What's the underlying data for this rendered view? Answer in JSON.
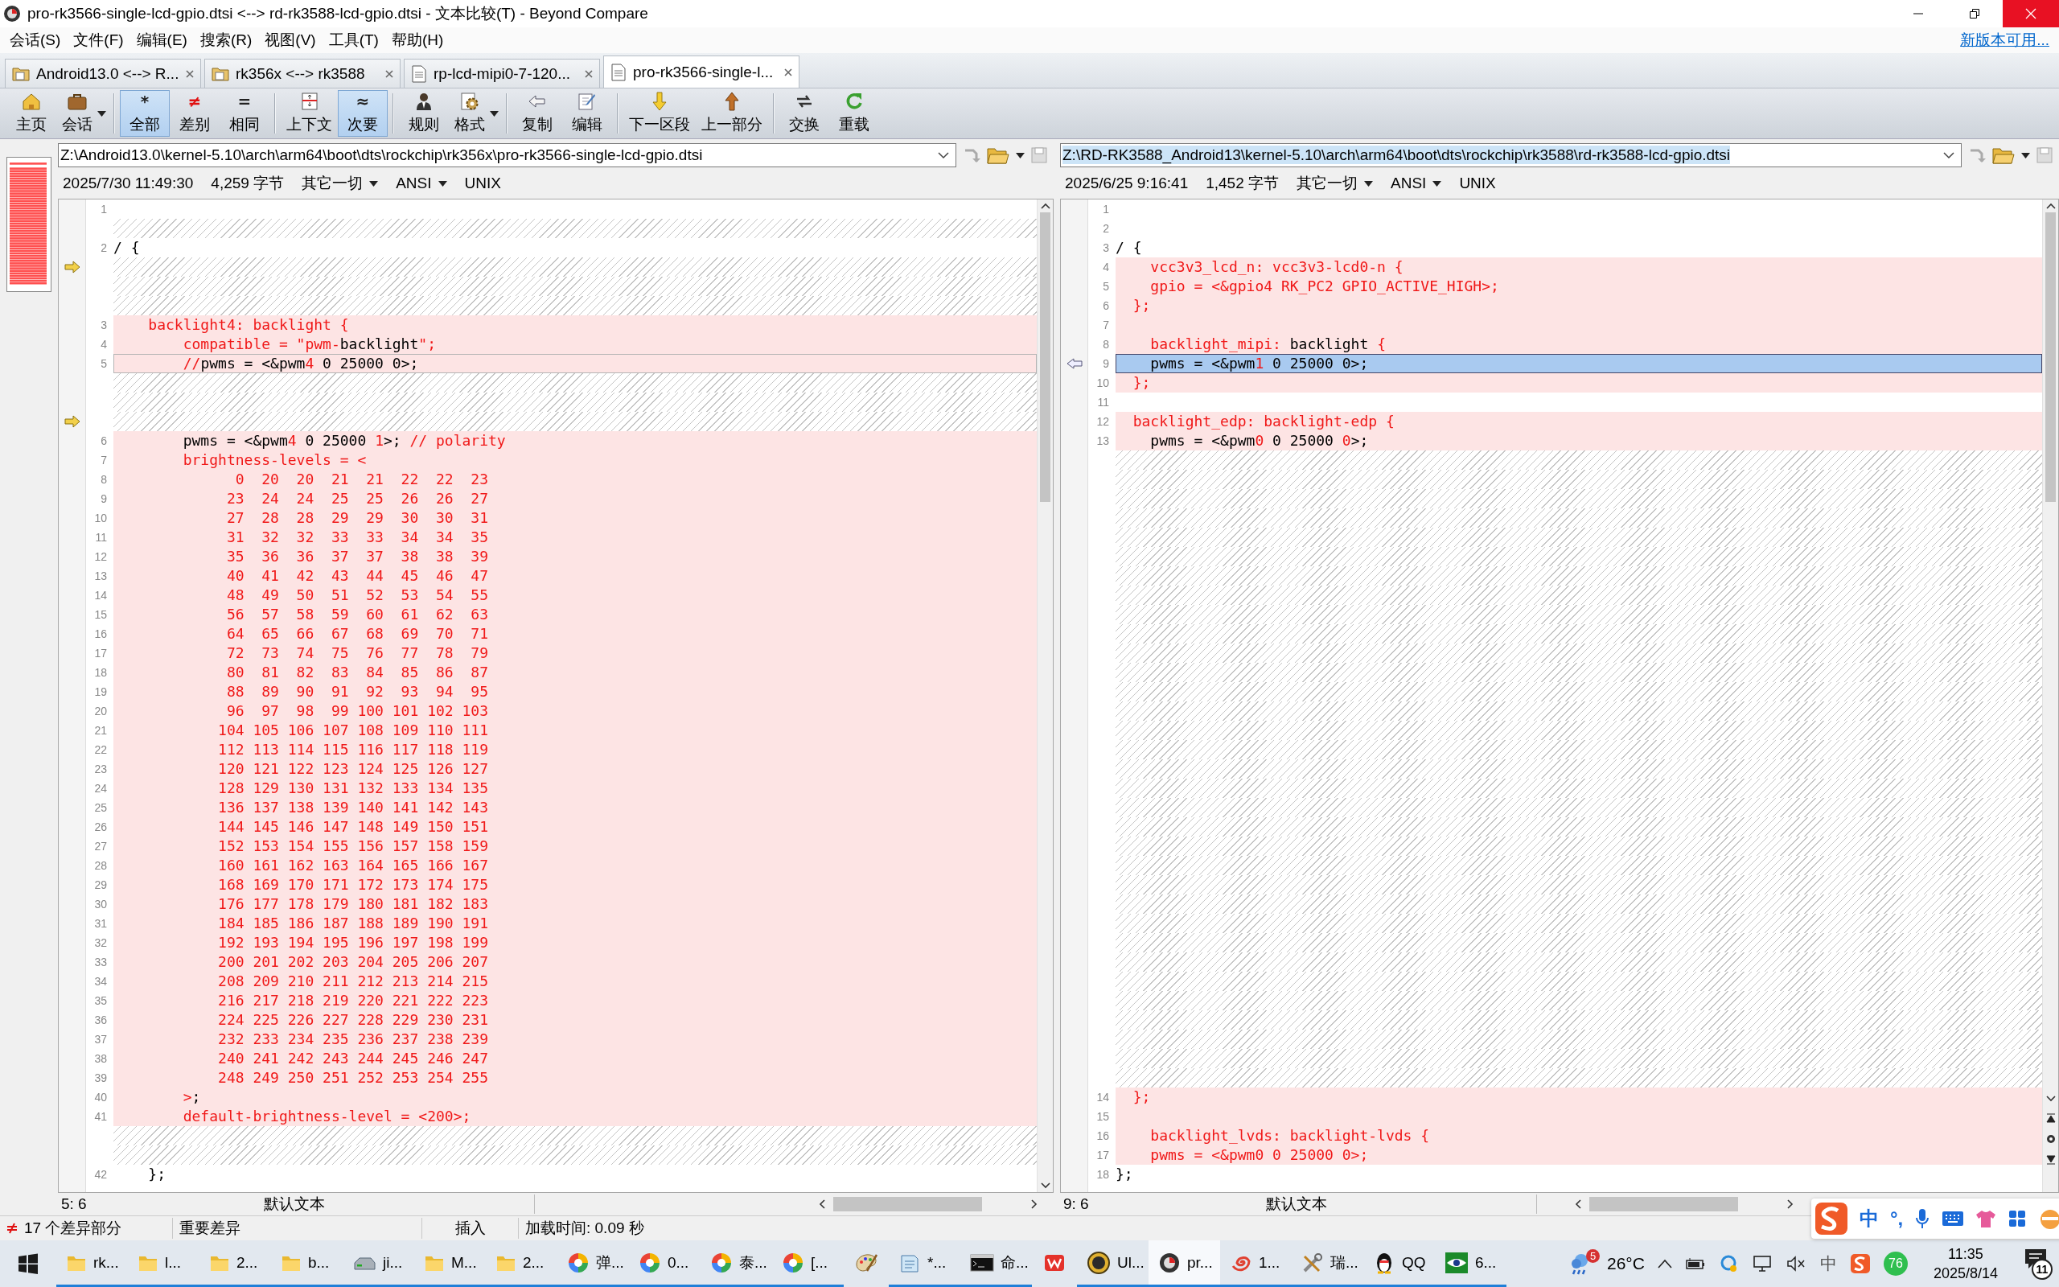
{
  "window": {
    "title": "pro-rk3566-single-lcd-gpio.dtsi <--> rd-rk3588-lcd-gpio.dtsi - 文本比较(T) - Beyond Compare"
  },
  "menu": [
    "会话(S)",
    "文件(F)",
    "编辑(E)",
    "搜索(R)",
    "视图(V)",
    "工具(T)",
    "帮助(H)"
  ],
  "update_link": "新版本可用...",
  "tabs": [
    {
      "label": "Android13.0 <--> R...",
      "kind": "folder",
      "selected": false
    },
    {
      "label": "rk356x <--> rk3588",
      "kind": "folder",
      "selected": false
    },
    {
      "label": "rp-lcd-mipi0-7-120...",
      "kind": "file",
      "selected": false
    },
    {
      "label": "pro-rk3566-single-l...",
      "kind": "file",
      "selected": true
    }
  ],
  "toolbar": [
    [
      {
        "label": "主页",
        "selected": false,
        "dropdown": false
      },
      {
        "label": "会话",
        "selected": false,
        "dropdown": true
      }
    ],
    [
      {
        "label": "全部",
        "glyph": "*",
        "selected": true,
        "dropdown": false
      },
      {
        "label": "差别",
        "glyph": "≠",
        "selected": false,
        "dropdown": false
      },
      {
        "label": "相同",
        "glyph": "=",
        "selected": false,
        "dropdown": false
      }
    ],
    [
      {
        "label": "上下文",
        "selected": false,
        "dropdown": false
      },
      {
        "label": "次要",
        "glyph": "≈",
        "selected": true,
        "dropdown": false
      }
    ],
    [
      {
        "label": "规则",
        "selected": false,
        "dropdown": false
      },
      {
        "label": "格式",
        "selected": false,
        "dropdown": true
      }
    ],
    [
      {
        "label": "复制",
        "selected": false,
        "dropdown": false
      },
      {
        "label": "编辑",
        "selected": false,
        "dropdown": false
      }
    ],
    [
      {
        "label": "下一区段",
        "selected": false,
        "dropdown": false
      },
      {
        "label": "上一部分",
        "selected": false,
        "dropdown": false
      }
    ],
    [
      {
        "label": "交换",
        "selected": false,
        "dropdown": false
      },
      {
        "label": "重载",
        "selected": false,
        "dropdown": false
      }
    ]
  ],
  "panes": [
    {
      "path": "Z:\\Android13.0\\kernel-5.10\\arch\\arm64\\boot\\dts\\rockchip\\rk356x\\pro-rk3566-single-lcd-gpio.dtsi",
      "focused": false,
      "nav_buttons": false,
      "date": "2025/7/30 11:49:30",
      "size": "4,259 字节",
      "filter": "其它一切",
      "encoding": "ANSI",
      "line_ending": "UNIX",
      "position": "5: 6",
      "syntax": "默认文本",
      "lines": [
        {
          "kind": "same",
          "number": "1",
          "selected": false
        },
        {
          "kind": "gap"
        },
        {
          "kind": "same",
          "number": "2",
          "text": "/ {",
          "selected": false
        },
        {
          "kind": "gap-arrow"
        },
        {
          "kind": "gap"
        },
        {
          "kind": "gap"
        },
        {
          "kind": "diff",
          "number": "3",
          "text": "    backlight4: backlight {",
          "selected": false
        },
        {
          "kind": "diff",
          "number": "4",
          "segments": [
            {
              "text": "        compatible = \"pwm-",
              "diff": true
            },
            {
              "text": "backlight",
              "diff": false
            },
            {
              "text": "\";",
              "diff": true
            }
          ],
          "selected": false
        },
        {
          "kind": "diff",
          "number": "5",
          "segments": [
            {
              "text": "        //",
              "diff": true
            },
            {
              "text": "pwms = <&pwm",
              "diff": false
            },
            {
              "text": "4",
              "diff": true
            },
            {
              "text": " 0 25000 0>;",
              "diff": false
            }
          ],
          "selected": true
        },
        {
          "kind": "gap"
        },
        {
          "kind": "gap"
        },
        {
          "kind": "gap-arrow"
        },
        {
          "kind": "diff",
          "number": "6",
          "segments": [
            {
              "text": "        pwms = <&pwm",
              "diff": false
            },
            {
              "text": "4",
              "diff": true
            },
            {
              "text": " 0 25000 ",
              "diff": false
            },
            {
              "text": "1",
              "diff": true
            },
            {
              "text": ">; ",
              "diff": false
            },
            {
              "text": "// polarity",
              "diff": true
            }
          ],
          "selected": false
        },
        {
          "kind": "diff",
          "number": "7",
          "text": "        brightness-levels = <",
          "selected": false
        },
        {
          "kind": "diff",
          "number": "8",
          "text": "              0  20  20  21  21  22  22  23",
          "selected": false
        },
        {
          "kind": "diff",
          "number": "9",
          "text": "             23  24  24  25  25  26  26  27",
          "selected": false
        },
        {
          "kind": "diff",
          "number": "10",
          "text": "             27  28  28  29  29  30  30  31",
          "selected": false
        },
        {
          "kind": "diff",
          "number": "11",
          "text": "             31  32  32  33  33  34  34  35",
          "selected": false
        },
        {
          "kind": "diff",
          "number": "12",
          "text": "             35  36  36  37  37  38  38  39",
          "selected": false
        },
        {
          "kind": "diff",
          "number": "13",
          "text": "             40  41  42  43  44  45  46  47",
          "selected": false
        },
        {
          "kind": "diff",
          "number": "14",
          "text": "             48  49  50  51  52  53  54  55",
          "selected": false
        },
        {
          "kind": "diff",
          "number": "15",
          "text": "             56  57  58  59  60  61  62  63",
          "selected": false
        },
        {
          "kind": "diff",
          "number": "16",
          "text": "             64  65  66  67  68  69  70  71",
          "selected": false
        },
        {
          "kind": "diff",
          "number": "17",
          "text": "             72  73  74  75  76  77  78  79",
          "selected": false
        },
        {
          "kind": "diff",
          "number": "18",
          "text": "             80  81  82  83  84  85  86  87",
          "selected": false
        },
        {
          "kind": "diff",
          "number": "19",
          "text": "             88  89  90  91  92  93  94  95",
          "selected": false
        },
        {
          "kind": "diff",
          "number": "20",
          "text": "             96  97  98  99 100 101 102 103",
          "selected": false
        },
        {
          "kind": "diff",
          "number": "21",
          "text": "            104 105 106 107 108 109 110 111",
          "selected": false
        },
        {
          "kind": "diff",
          "number": "22",
          "text": "            112 113 114 115 116 117 118 119",
          "selected": false
        },
        {
          "kind": "diff",
          "number": "23",
          "text": "            120 121 122 123 124 125 126 127",
          "selected": false
        },
        {
          "kind": "diff",
          "number": "24",
          "text": "            128 129 130 131 132 133 134 135",
          "selected": false
        },
        {
          "kind": "diff",
          "number": "25",
          "text": "            136 137 138 139 140 141 142 143",
          "selected": false
        },
        {
          "kind": "diff",
          "number": "26",
          "text": "            144 145 146 147 148 149 150 151",
          "selected": false
        },
        {
          "kind": "diff",
          "number": "27",
          "text": "            152 153 154 155 156 157 158 159",
          "selected": false
        },
        {
          "kind": "diff",
          "number": "28",
          "text": "            160 161 162 163 164 165 166 167",
          "selected": false
        },
        {
          "kind": "diff",
          "number": "29",
          "text": "            168 169 170 171 172 173 174 175",
          "selected": false
        },
        {
          "kind": "diff",
          "number": "30",
          "text": "            176 177 178 179 180 181 182 183",
          "selected": false
        },
        {
          "kind": "diff",
          "number": "31",
          "text": "            184 185 186 187 188 189 190 191",
          "selected": false
        },
        {
          "kind": "diff",
          "number": "32",
          "text": "            192 193 194 195 196 197 198 199",
          "selected": false
        },
        {
          "kind": "diff",
          "number": "33",
          "text": "            200 201 202 203 204 205 206 207",
          "selected": false
        },
        {
          "kind": "diff",
          "number": "34",
          "text": "            208 209 210 211 212 213 214 215",
          "selected": false
        },
        {
          "kind": "diff",
          "number": "35",
          "text": "            216 217 218 219 220 221 222 223",
          "selected": false
        },
        {
          "kind": "diff",
          "number": "36",
          "text": "            224 225 226 227 228 229 230 231",
          "selected": false
        },
        {
          "kind": "diff",
          "number": "37",
          "text": "            232 233 234 235 236 237 238 239",
          "selected": false
        },
        {
          "kind": "diff",
          "number": "38",
          "text": "            240 241 242 243 244 245 246 247",
          "selected": false
        },
        {
          "kind": "diff",
          "number": "39",
          "text": "            248 249 250 251 252 253 254 255",
          "selected": false
        },
        {
          "kind": "diff",
          "number": "40",
          "segments": [
            {
              "text": "        >",
              "diff": true
            },
            {
              "text": ";",
              "diff": false
            }
          ],
          "selected": false
        },
        {
          "kind": "diff",
          "number": "41",
          "text": "        default-brightness-level = <200>;",
          "selected": false
        },
        {
          "kind": "gap"
        },
        {
          "kind": "gap"
        },
        {
          "kind": "same",
          "number": "42",
          "text": "    };",
          "selected": false
        }
      ]
    },
    {
      "path": "Z:\\RD-RK3588_Android13\\kernel-5.10\\arch\\arm64\\boot\\dts\\rockchip\\rk3588\\rd-rk3588-lcd-gpio.dtsi",
      "focused": true,
      "nav_buttons": true,
      "date": "2025/6/25 9:16:41",
      "size": "1,452 字节",
      "filter": "其它一切",
      "encoding": "ANSI",
      "line_ending": "UNIX",
      "position": "9: 6",
      "syntax": "默认文本",
      "lines": [
        {
          "kind": "same",
          "number": "1",
          "selected": false
        },
        {
          "kind": "same",
          "number": "2",
          "selected": false
        },
        {
          "kind": "same",
          "number": "3",
          "text": "/ {",
          "selected": false
        },
        {
          "kind": "diff",
          "number": "4",
          "text": "    vcc3v3_lcd_n: vcc3v3-lcd0-n {",
          "selected": false
        },
        {
          "kind": "diff",
          "number": "5",
          "text": "    gpio = <&gpio4 RK_PC2 GPIO_ACTIVE_HIGH>;",
          "selected": false
        },
        {
          "kind": "diff",
          "number": "6",
          "text": "  };",
          "selected": false
        },
        {
          "kind": "diff",
          "number": "7",
          "selected": false
        },
        {
          "kind": "diff",
          "number": "8",
          "segments": [
            {
              "text": "    backlight_mipi: ",
              "diff": true
            },
            {
              "text": "backlight",
              "diff": false
            },
            {
              "text": " {",
              "diff": true
            }
          ],
          "selected": false
        },
        {
          "kind": "diff",
          "number": "9",
          "segments": [
            {
              "text": "    pwms = <&pwm",
              "diff": false
            },
            {
              "text": "1",
              "diff": true
            },
            {
              "text": " 0 25000 0>;",
              "diff": false
            }
          ],
          "selected": true
        },
        {
          "kind": "diff",
          "number": "10",
          "text": "  };",
          "selected": false
        },
        {
          "kind": "same",
          "number": "11",
          "selected": false
        },
        {
          "kind": "diff",
          "number": "12",
          "text": "  backlight_edp: backlight-edp {",
          "selected": false
        },
        {
          "kind": "diff",
          "number": "13",
          "segments": [
            {
              "text": "    pwms = <&pwm",
              "diff": false
            },
            {
              "text": "0",
              "diff": true
            },
            {
              "text": " 0 25000 ",
              "diff": false
            },
            {
              "text": "0",
              "diff": true
            },
            {
              "text": ">;",
              "diff": false
            }
          ],
          "selected": false
        },
        {
          "kind": "gap"
        },
        {
          "kind": "gap"
        },
        {
          "kind": "gap"
        },
        {
          "kind": "gap"
        },
        {
          "kind": "gap"
        },
        {
          "kind": "gap"
        },
        {
          "kind": "gap"
        },
        {
          "kind": "gap"
        },
        {
          "kind": "gap"
        },
        {
          "kind": "gap"
        },
        {
          "kind": "gap"
        },
        {
          "kind": "gap"
        },
        {
          "kind": "gap"
        },
        {
          "kind": "gap"
        },
        {
          "kind": "gap"
        },
        {
          "kind": "gap"
        },
        {
          "kind": "gap"
        },
        {
          "kind": "gap"
        },
        {
          "kind": "gap"
        },
        {
          "kind": "gap"
        },
        {
          "kind": "gap"
        },
        {
          "kind": "gap"
        },
        {
          "kind": "gap"
        },
        {
          "kind": "gap"
        },
        {
          "kind": "gap"
        },
        {
          "kind": "gap"
        },
        {
          "kind": "gap"
        },
        {
          "kind": "gap"
        },
        {
          "kind": "gap"
        },
        {
          "kind": "gap"
        },
        {
          "kind": "gap"
        },
        {
          "kind": "gap"
        },
        {
          "kind": "gap"
        },
        {
          "kind": "diff",
          "number": "14",
          "text": "  };",
          "selected": false
        },
        {
          "kind": "diff",
          "number": "15",
          "selected": false
        },
        {
          "kind": "diff",
          "number": "16",
          "text": "    backlight_lvds: backlight-lvds {",
          "selected": false
        },
        {
          "kind": "diff",
          "number": "17",
          "text": "    pwms = <&pwm0 0 25000 0>;",
          "selected": false
        },
        {
          "kind": "same",
          "number": "18",
          "text": "};",
          "selected": false
        }
      ]
    }
  ],
  "status_bar": {
    "diff_count": "17 个差异部分",
    "importance": "重要差异",
    "mode": "插入",
    "load_time": "加载时间: 0.09 秒"
  },
  "ime_bar": {
    "mode": "中",
    "punctuation": "°,"
  },
  "taskbar": {
    "apps": [
      {
        "kind": "folder",
        "label": "rk...",
        "running": true,
        "selected": false
      },
      {
        "kind": "folder",
        "label": "l...",
        "running": true,
        "selected": false
      },
      {
        "kind": "folder",
        "label": "2...",
        "running": true,
        "selected": false
      },
      {
        "kind": "folder",
        "label": "b...",
        "running": true,
        "selected": false
      },
      {
        "kind": "drive",
        "label": "ji...",
        "running": true,
        "selected": false
      },
      {
        "kind": "folder",
        "label": "M...",
        "running": true,
        "selected": false
      },
      {
        "kind": "folder",
        "label": "2...",
        "running": true,
        "selected": false
      },
      {
        "kind": "swirl",
        "label": "弹...",
        "running": true,
        "selected": false
      },
      {
        "kind": "swirl",
        "label": "0...",
        "running": true,
        "selected": false
      },
      {
        "kind": "swirl",
        "label": "泰...",
        "running": true,
        "selected": false
      },
      {
        "kind": "swirl",
        "label": "[...",
        "running": true,
        "selected": false
      },
      {
        "kind": "paint",
        "running": false,
        "selected": false
      },
      {
        "kind": "notepad",
        "label": "*...",
        "running": true,
        "selected": false
      },
      {
        "kind": "terminal",
        "label": "命...",
        "running": true,
        "selected": false
      },
      {
        "kind": "wps",
        "running": false,
        "selected": false
      },
      {
        "kind": "ue",
        "label": "Ul...",
        "running": true,
        "selected": false
      },
      {
        "kind": "compare",
        "label": "pr...",
        "running": true,
        "selected": true
      },
      {
        "kind": "spiral",
        "label": "1...",
        "running": true,
        "selected": false
      },
      {
        "kind": "tools",
        "label": "瑞...",
        "running": true,
        "selected": false
      },
      {
        "kind": "qq",
        "label": "QQ",
        "running": true,
        "selected": false
      },
      {
        "kind": "eye",
        "label": "6...",
        "running": true,
        "selected": false
      }
    ],
    "weather_badge": "5",
    "temperature": "26°C",
    "ime_mode": "中",
    "score": "76",
    "time": "11:35",
    "date": "2025/8/14",
    "notifications": "11"
  }
}
